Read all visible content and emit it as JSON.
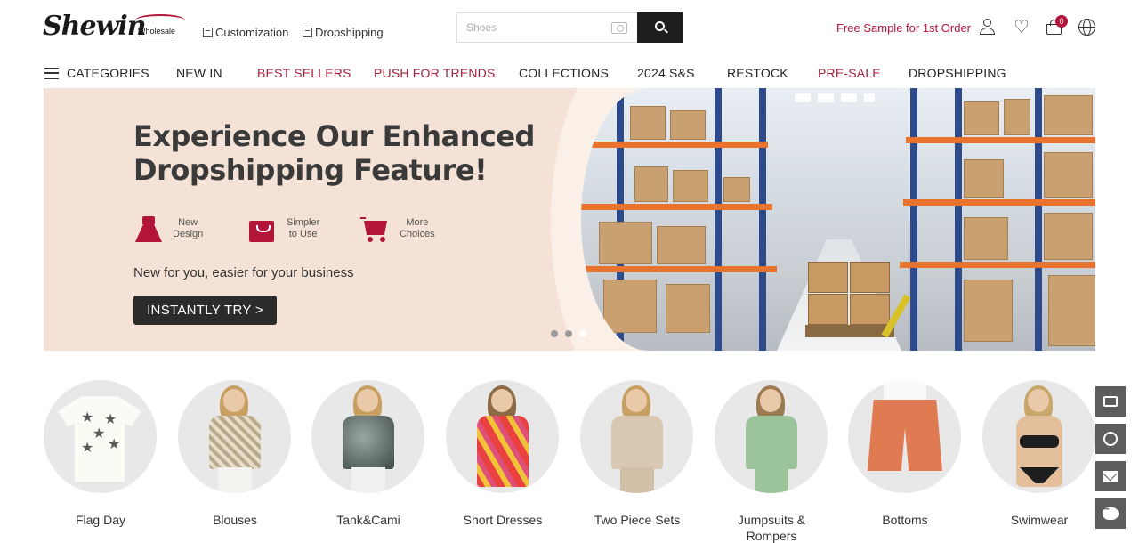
{
  "header": {
    "logo_text": "Shewin",
    "logo_sub": "Wholesale",
    "links": [
      "Customization",
      "Dropshipping"
    ],
    "search_placeholder": "Shoes",
    "free_sample": "Free Sample for 1st Order",
    "cart_count": "0"
  },
  "nav": {
    "items": [
      {
        "label": "CATEGORIES",
        "highlight": false
      },
      {
        "label": "NEW IN",
        "highlight": false
      },
      {
        "label": "BEST SELLERS",
        "highlight": true
      },
      {
        "label": "PUSH FOR TRENDS",
        "highlight": true
      },
      {
        "label": "COLLECTIONS",
        "highlight": false
      },
      {
        "label": "2024 S&S",
        "highlight": false
      },
      {
        "label": "RESTOCK",
        "highlight": false
      },
      {
        "label": "PRE-SALE",
        "highlight": true
      },
      {
        "label": "DROPSHIPPING",
        "highlight": false
      }
    ]
  },
  "banner": {
    "title_line1": "Experience Our Enhanced",
    "title_line2": "Dropshipping Feature!",
    "features": [
      {
        "line1": "New",
        "line2": "Design",
        "icon": "dress-icon"
      },
      {
        "line1": "Simpler",
        "line2": "to Use",
        "icon": "shopping-bag-icon"
      },
      {
        "line1": "More",
        "line2": "Choices",
        "icon": "shopping-cart-icon"
      }
    ],
    "subtitle": "New for you, easier for your business",
    "cta": "INSTANTLY TRY  >",
    "slides": 3,
    "active_slide": 3
  },
  "categories": [
    {
      "label": "Flag Day"
    },
    {
      "label": "Blouses"
    },
    {
      "label": "Tank&Cami"
    },
    {
      "label": "Short Dresses"
    },
    {
      "label": "Two Piece Sets"
    },
    {
      "label": "Jumpsuits &\nRompers"
    },
    {
      "label": "Bottoms"
    },
    {
      "label": "Swimwear"
    }
  ],
  "side_buttons": [
    "app-icon",
    "whatsapp-icon",
    "mail-icon",
    "chat-icon"
  ],
  "colors": {
    "accent": "#b3143a",
    "nav_highlight": "#a5203a",
    "banner_bg": "#f4e2d6",
    "cta_bg": "#2b2b2b"
  }
}
